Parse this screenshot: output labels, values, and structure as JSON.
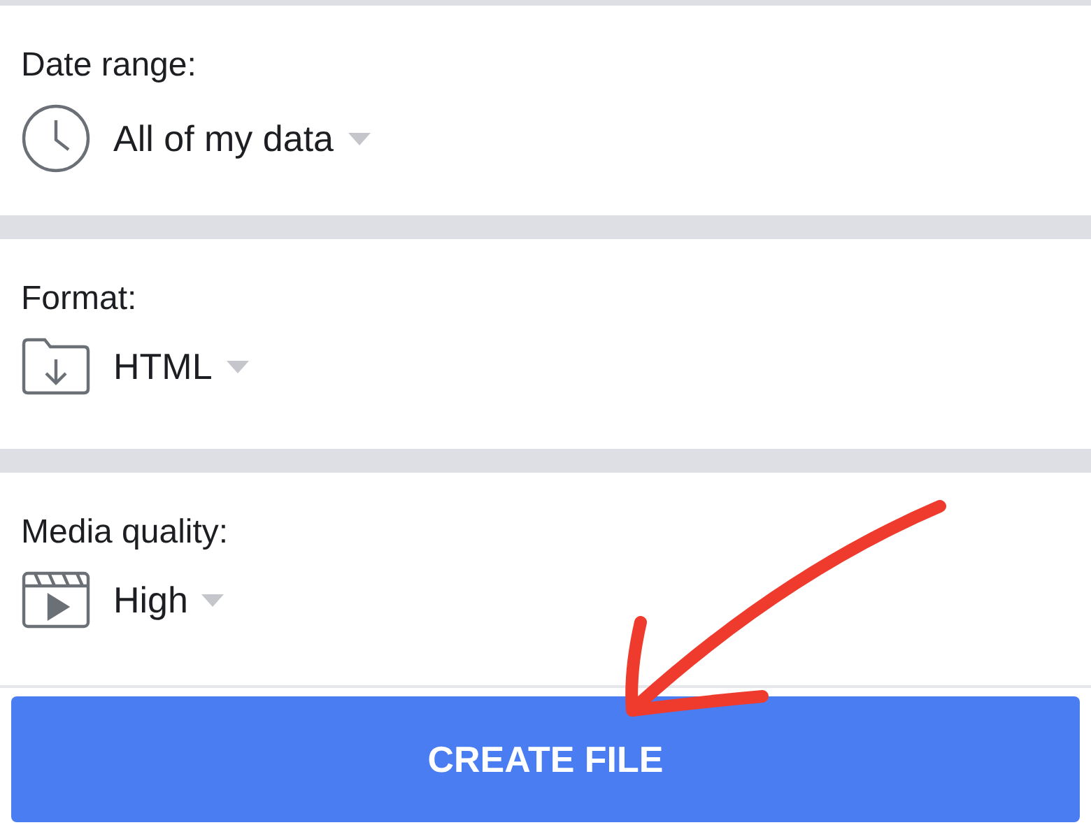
{
  "settings": [
    {
      "kind": "date",
      "label": "Date range:",
      "value": "All of my data"
    },
    {
      "kind": "format",
      "label": "Format:",
      "value": "HTML"
    },
    {
      "kind": "media",
      "label": "Media quality:",
      "value": "High"
    }
  ],
  "button": {
    "label": "CREATE FILE"
  },
  "annotation": {
    "kind": "arrow"
  }
}
